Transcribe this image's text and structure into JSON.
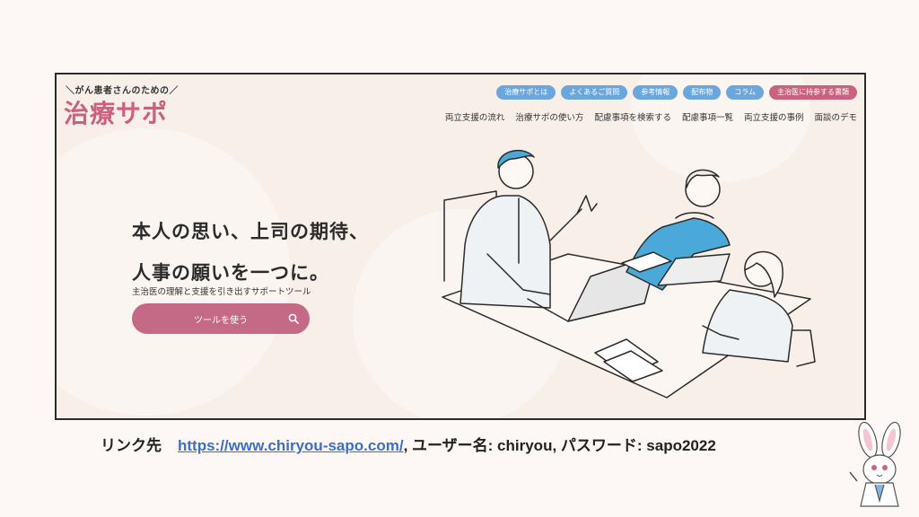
{
  "site": {
    "tagline": "＼がん患者さんのための／",
    "logo": "治療サポ"
  },
  "pill_nav": [
    {
      "label": "治療サポとは",
      "color": "#6ba7dd"
    },
    {
      "label": "よくあるご質問",
      "color": "#6ba7dd"
    },
    {
      "label": "参考情報",
      "color": "#6ba7dd"
    },
    {
      "label": "配布物",
      "color": "#6ba7dd"
    },
    {
      "label": "コラム",
      "color": "#6ba7dd"
    },
    {
      "label": "主治医に持参する書類",
      "color": "#c9617f"
    }
  ],
  "main_nav": [
    {
      "label": "両立支援の流れ"
    },
    {
      "label": "治療サポの使い方"
    },
    {
      "label": "配慮事項を検索する"
    },
    {
      "label": "配慮事項一覧"
    },
    {
      "label": "両立支援の事例"
    },
    {
      "label": "面談のデモ"
    }
  ],
  "hero": {
    "headline_line1": "本人の思い、上司の期待、",
    "headline_line2": "人事の願いを一つに。",
    "subtext": "主治医の理解と支援を引き出すサポートツール",
    "cta_label": "ツールを使う",
    "cta_icon": "search-icon"
  },
  "footer": {
    "prefix": "リンク先",
    "url": "https://www.chiryou-sapo.com/",
    "suffix": ", ユーザー名: chiryou, パスワード: sapo2022"
  },
  "colors": {
    "brand_pink": "#c9617f",
    "pill_blue": "#6ba7dd",
    "link_blue": "#3b6fc4",
    "page_bg": "#f8efe9"
  }
}
